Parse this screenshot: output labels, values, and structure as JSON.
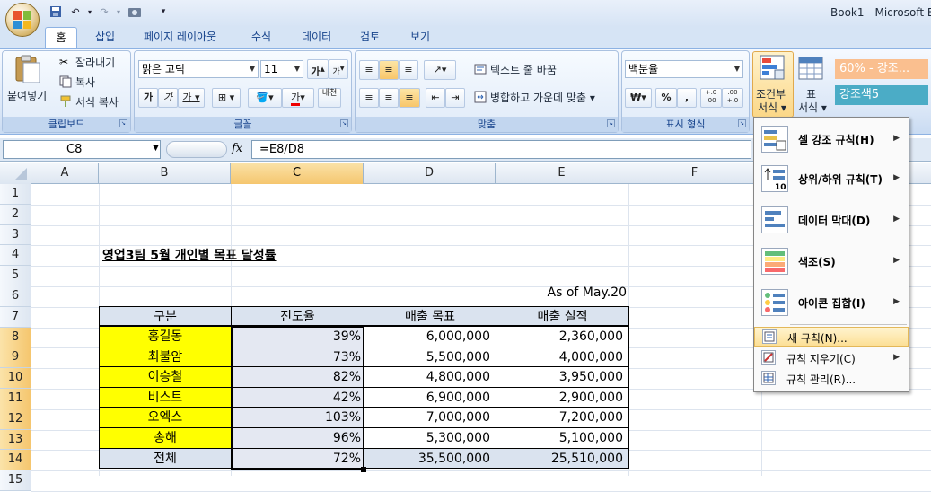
{
  "window": {
    "title": "Book1 - Microsoft E"
  },
  "tabs": [
    "홈",
    "삽입",
    "페이지 레이아웃",
    "수식",
    "데이터",
    "검토",
    "보기"
  ],
  "ribbon": {
    "clipboard": {
      "paste": "붙여넣기",
      "cut": "잘라내기",
      "copy": "복사",
      "format_painter": "서식 복사",
      "label": "클립보드"
    },
    "font": {
      "name": "맑은 고딕",
      "size": "11",
      "grow": "가",
      "shrink": "가",
      "bold": "가",
      "italic": "가",
      "underline": "가",
      "label": "글꼴",
      "strike": "내천"
    },
    "alignment": {
      "wrap": "텍스트 줄 바꿈",
      "merge": "병합하고 가운데 맞춤",
      "label": "맞춤"
    },
    "number": {
      "format": "백분율",
      "currency": "₩",
      "percent": "%",
      "comma": ",",
      "inc": "+.0 .00",
      "dec": ".00 +.0",
      "label": "표시 형식"
    },
    "styles": {
      "conditional": "조건부",
      "conditional2": "서식",
      "table": "표",
      "table2": "서식",
      "style1": "60% - 강조...",
      "style2": "강조색5"
    }
  },
  "formula_bar": {
    "name_box": "C8",
    "fx": "fx",
    "formula": "=E8/D8"
  },
  "columns": [
    "A",
    "B",
    "C",
    "D",
    "E",
    "F"
  ],
  "rows": [
    "1",
    "2",
    "3",
    "4",
    "5",
    "6",
    "7",
    "8",
    "9",
    "10",
    "11",
    "12",
    "13",
    "14",
    "15"
  ],
  "sheet": {
    "title": "영업3팀 5월 개인별 목표 달성률",
    "as_of": "As of May.20",
    "headers": [
      "구분",
      "진도율",
      "매출 목표",
      "매출 실적"
    ],
    "data": [
      {
        "name": "홍길동",
        "pct": "39%",
        "target": "6,000,000",
        "actual": "2,360,000"
      },
      {
        "name": "최불암",
        "pct": "73%",
        "target": "5,500,000",
        "actual": "4,000,000"
      },
      {
        "name": "이승철",
        "pct": "82%",
        "target": "4,800,000",
        "actual": "3,950,000"
      },
      {
        "name": "비스트",
        "pct": "42%",
        "target": "6,900,000",
        "actual": "2,900,000"
      },
      {
        "name": "오엑스",
        "pct": "103%",
        "target": "7,000,000",
        "actual": "7,200,000"
      },
      {
        "name": "송해",
        "pct": "96%",
        "target": "5,300,000",
        "actual": "5,100,000"
      }
    ],
    "total": {
      "name": "전체",
      "pct": "72%",
      "target": "35,500,000",
      "actual": "25,510,000"
    }
  },
  "menu": {
    "items": [
      {
        "label": "셀 강조 규칙(H)",
        "icon": "highlight-cells-icon"
      },
      {
        "label": "상위/하위 규칙(T)",
        "icon": "top-bottom-icon"
      },
      {
        "label": "데이터 막대(D)",
        "icon": "data-bars-icon"
      },
      {
        "label": "색조(S)",
        "icon": "color-scales-icon"
      },
      {
        "label": "아이콘 집합(I)",
        "icon": "icon-sets-icon"
      }
    ],
    "small": [
      {
        "label": "새 규칙(N)...",
        "icon": "new-rule-icon"
      },
      {
        "label": "규칙 지우기(C)",
        "icon": "clear-rules-icon"
      },
      {
        "label": "규칙 관리(R)...",
        "icon": "manage-rules-icon"
      }
    ]
  }
}
